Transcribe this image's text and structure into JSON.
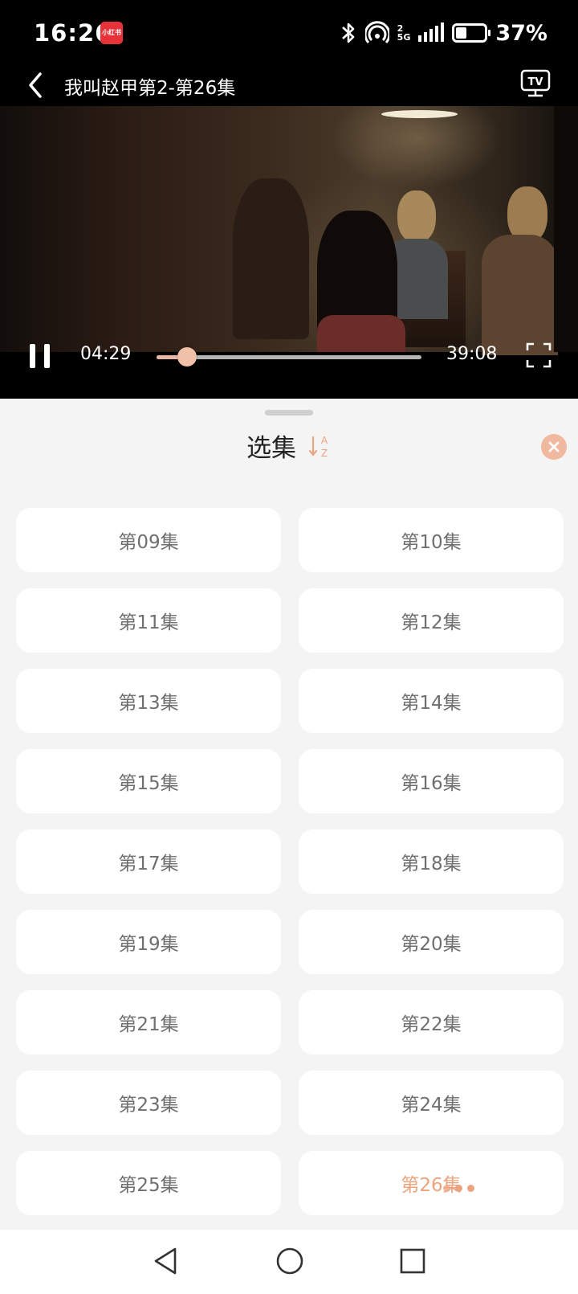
{
  "status_bar": {
    "time": "16:26",
    "app_badge": "小红书",
    "network_label": "5G",
    "sim_index": "2",
    "battery_percent": "37%",
    "battery_level": 0.37
  },
  "header": {
    "title": "我叫赵甲第2-第26集",
    "back_icon": "chevron-left-icon",
    "cast_icon": "tv-cast-icon"
  },
  "player": {
    "current_time": "04:29",
    "duration": "39:08",
    "progress": 0.115,
    "state": "playing"
  },
  "episode_sheet": {
    "title": "选集",
    "sort_icon": "sort-az-icon",
    "close_icon": "close-icon",
    "accent_color": "#eca480",
    "episodes": [
      {
        "label": "第09集",
        "active": false
      },
      {
        "label": "第10集",
        "active": false
      },
      {
        "label": "第11集",
        "active": false
      },
      {
        "label": "第12集",
        "active": false
      },
      {
        "label": "第13集",
        "active": false
      },
      {
        "label": "第14集",
        "active": false
      },
      {
        "label": "第15集",
        "active": false
      },
      {
        "label": "第16集",
        "active": false
      },
      {
        "label": "第17集",
        "active": false
      },
      {
        "label": "第18集",
        "active": false
      },
      {
        "label": "第19集",
        "active": false
      },
      {
        "label": "第20集",
        "active": false
      },
      {
        "label": "第21集",
        "active": false
      },
      {
        "label": "第22集",
        "active": false
      },
      {
        "label": "第23集",
        "active": false
      },
      {
        "label": "第24集",
        "active": false
      },
      {
        "label": "第25集",
        "active": false
      },
      {
        "label": "第26集",
        "active": true
      }
    ]
  }
}
